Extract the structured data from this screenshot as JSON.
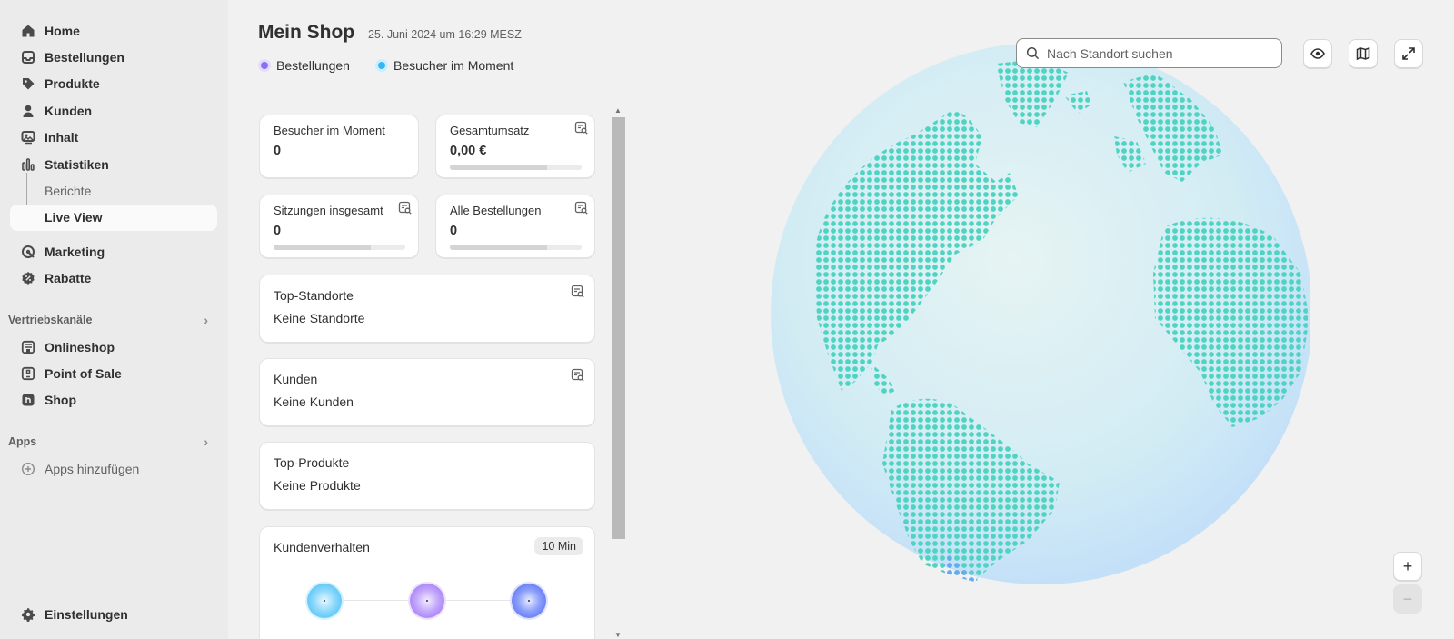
{
  "sidebar": {
    "items": [
      {
        "label": "Home",
        "icon": "home-icon"
      },
      {
        "label": "Bestellungen",
        "icon": "inbox-icon"
      },
      {
        "label": "Produkte",
        "icon": "tag-icon"
      },
      {
        "label": "Kunden",
        "icon": "person-icon"
      },
      {
        "label": "Inhalt",
        "icon": "image-icon"
      },
      {
        "label": "Statistiken",
        "icon": "bar-chart-icon"
      }
    ],
    "sub_items": [
      {
        "label": "Berichte"
      },
      {
        "label": "Live View"
      }
    ],
    "items2": [
      {
        "label": "Marketing",
        "icon": "target-icon"
      },
      {
        "label": "Rabatte",
        "icon": "discount-icon"
      }
    ],
    "sales_channels_heading": "Vertriebskanäle",
    "channels": [
      {
        "label": "Onlineshop",
        "icon": "store-icon"
      },
      {
        "label": "Point of Sale",
        "icon": "pos-icon"
      },
      {
        "label": "Shop",
        "icon": "shop-app-icon"
      }
    ],
    "apps_heading": "Apps",
    "add_apps_label": "Apps hinzufügen",
    "settings_label": "Einstellungen"
  },
  "header": {
    "title": "Mein Shop",
    "date": "25. Juni 2024 um 16:29 MESZ"
  },
  "legend": {
    "orders_label": "Bestellungen",
    "orders_color": "#8c6ef3",
    "visitors_label": "Besucher im Moment",
    "visitors_color": "#39b6f2"
  },
  "metrics": {
    "visitors_now": {
      "label": "Besucher im Moment",
      "value": "0"
    },
    "total_sales": {
      "label": "Gesamtumsatz",
      "value": "0,00 €"
    },
    "sessions": {
      "label": "Sitzungen insgesamt",
      "value": "0"
    },
    "all_orders": {
      "label": "Alle Bestellungen",
      "value": "0"
    }
  },
  "panels": {
    "top_locations": {
      "title": "Top-Standorte",
      "empty": "Keine Standorte"
    },
    "customers": {
      "title": "Kunden",
      "empty": "Keine Kunden"
    },
    "top_products": {
      "title": "Top-Produkte",
      "empty": "Keine Produkte"
    },
    "behavior": {
      "title": "Kundenverhalten",
      "badge": "10 Min"
    }
  },
  "map": {
    "search_placeholder": "Nach Standort suchen",
    "zoom_in": "+",
    "zoom_out": "−"
  }
}
